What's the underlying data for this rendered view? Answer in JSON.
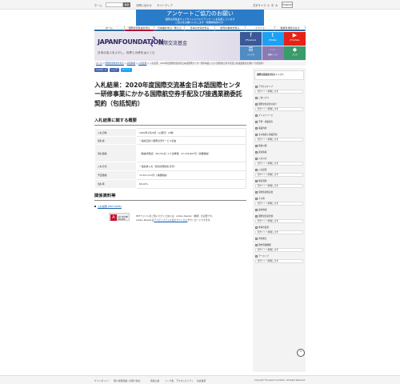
{
  "header": {
    "links_left": [
      "ホーム",
      "お問い合わせ",
      "サイトマップ"
    ],
    "search_placeholder": "",
    "search_button": "検索",
    "text_size_label": "文字サイズ",
    "text_sizes": [
      "小",
      "中",
      "大"
    ],
    "english_button": "English"
  },
  "banner": {
    "title": "アンケートご協力のお願い",
    "line1": "国際交流基金ウェブサイトについてアンケートを実施しています",
    "line2": "ご協力をお願いいたします（所要時間約5分）"
  },
  "nav": {
    "items": [
      "ホーム",
      "国際交流基金を知る",
      "日本語を学ぶ・教える",
      "日本の文化を知る",
      "世界の動向を知る",
      "イベント",
      "助成を求めるなら"
    ]
  },
  "hero": {
    "logo_en": "JAPANFOUNDATION",
    "logo_jp": "国際交流基金",
    "tagline": "日本の友人をふやし、世界との絆をはぐくむ"
  },
  "tiles": [
    {
      "icon": "f",
      "label": "JFFacebook",
      "color": "#3b5998"
    },
    {
      "icon": "t",
      "label": "JFTwitter",
      "color": "#1da1f2"
    },
    {
      "icon": "▶",
      "label": "JFYouTube",
      "color": "#e62117"
    },
    {
      "icon": "☰",
      "label": "メルマガ",
      "color": "#4e8cc2"
    },
    {
      "icon": "⋯",
      "label": "関連リンク",
      "color": "#8a7bb5"
    },
    {
      "icon": "◆",
      "label": "ブログ",
      "color": "#3a9b6b"
    }
  ],
  "breadcrumb": {
    "items": [
      "ホーム",
      "国際交流基金を知る",
      "調達情報",
      "入札結果",
      "入札結果：2020年度国際交流基金日本語国際センター研修事業にかかる国際航空券手配及び接遇業務委託契約（包括契約）"
    ]
  },
  "social": [
    {
      "label": "いいね！ 0",
      "color": "#4267b2"
    },
    {
      "label": "シェア",
      "color": "#4267b2"
    },
    {
      "label": "ツイート",
      "color": "#1da1f2"
    }
  ],
  "page": {
    "title": "入札結果：2020年度国際交流基金日本語国際センター研修事業にかかる国際航空券手配及び接遇業務委託契約（包括契約）",
    "summary_heading": "入札結果に関する概要",
    "related_heading": "関係資料等"
  },
  "summary": [
    {
      "k": "入札日時",
      "v": "2020年1月28日（火曜日）15時"
    },
    {
      "k": "落札者",
      "v": "一般社団法人国際交流サービス協会"
    },
    {
      "k": "落札価格",
      "v": "（税抜評価点）48,722点 / 1人当単価：47,126,967円（消費税抜）"
    },
    {
      "k": "入札方式",
      "v": "一般競争入札（総合評価落札方式）"
    },
    {
      "k": "予定価格",
      "v": "72,911,117円（消費税抜）"
    },
    {
      "k": "落札率",
      "v": "66.10%"
    }
  ],
  "related": {
    "pdf_link": "入札結果 [PDF:92KB]",
    "reader_label": "Get ADOBE READER",
    "note1": "PDFファイルをご覧いただくためには、Adobe Reader（無償）が必要です。",
    "note2_pre": "Adobe Readerは",
    "note2_link": "アドビシステムズ社のサイトから",
    "note2_post": "ダウンロードできます。"
  },
  "sidebar": {
    "top_box": "国際交流基金を知るトップへ",
    "items": [
      {
        "label": "アクセスマップ",
        "feature": "新サイトへ移動します"
      },
      {
        "label": "ごあいさつ",
        "feature": ""
      },
      {
        "label": "国際交流基金の紹介",
        "feature": "新サイトへ移動します"
      },
      {
        "label": "プレスリリース",
        "feature": ""
      },
      {
        "label": "予算・事業報告",
        "feature": ""
      },
      {
        "label": "事業内容",
        "feature": ""
      },
      {
        "label": "主な取組と事業評価",
        "feature": "新サイトへ移動します"
      },
      {
        "label": "情報公開",
        "feature": ""
      },
      {
        "label": "調達情報",
        "feature": ""
      },
      {
        "label": "入札公告",
        "feature": "新サイトへ移動します"
      },
      {
        "label": "入札結果",
        "feature": "新サイトへ移動します"
      },
      {
        "label": "随意契約",
        "feature": "新サイトへ移動します"
      },
      {
        "label": "契約監視委員会",
        "feature": ""
      },
      {
        "label": "その他",
        "feature": "新サイトへ移動します"
      },
      {
        "label": "採用情報",
        "feature": ""
      },
      {
        "label": "国際交流基金賞",
        "feature": "新サイトへ移動します"
      },
      {
        "label": "地球市民賞",
        "feature": "新サイトへ移動します"
      },
      {
        "label": "海外拠点",
        "feature": ""
      },
      {
        "label": "国内附属機関",
        "feature": "新サイトへ移動します"
      },
      {
        "label": "アーカイブ",
        "feature": "新サイトへ移動します"
      }
    ]
  },
  "footer": {
    "links": [
      "サイトポリシー",
      "個人情報保護への取り組み",
      "情報公開",
      "リンク集",
      "アクセシビリティ",
      "免責事項"
    ],
    "copyright": "Copyright The Japan Foundation, All Rights Reserved."
  }
}
